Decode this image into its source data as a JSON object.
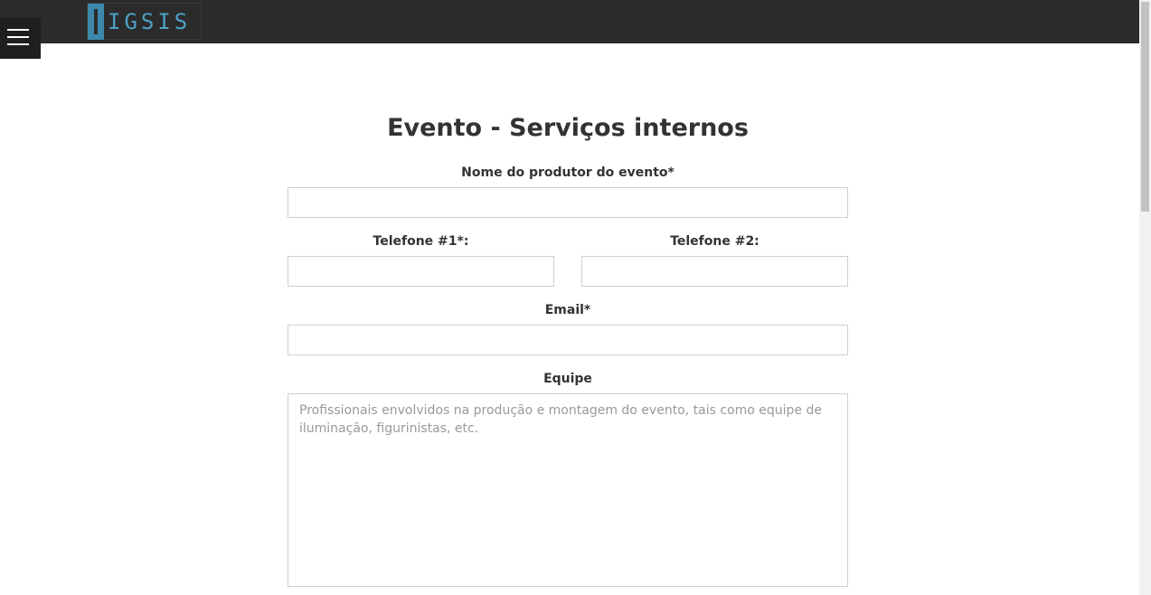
{
  "header": {
    "logo_text": "IGSIS",
    "menu_icon": "hamburger-menu-icon",
    "logo_colors": {
      "mark": "#3e88ad",
      "text": "#4d9fc6"
    },
    "background": "#2b2b2b"
  },
  "form": {
    "title": "Evento - Serviços internos",
    "producer_name": {
      "label": "Nome do produtor do evento*",
      "value": "",
      "placeholder": ""
    },
    "phone1": {
      "label": "Telefone #1*:",
      "value": "",
      "placeholder": ""
    },
    "phone2": {
      "label": "Telefone #2:",
      "value": "",
      "placeholder": ""
    },
    "email": {
      "label": "Email*",
      "value": "",
      "placeholder": ""
    },
    "team": {
      "label": "Equipe",
      "value": "",
      "placeholder": "Profissionais envolvidos na produção e montagem do evento, tais como equipe de iluminação, figurinistas, etc."
    }
  }
}
